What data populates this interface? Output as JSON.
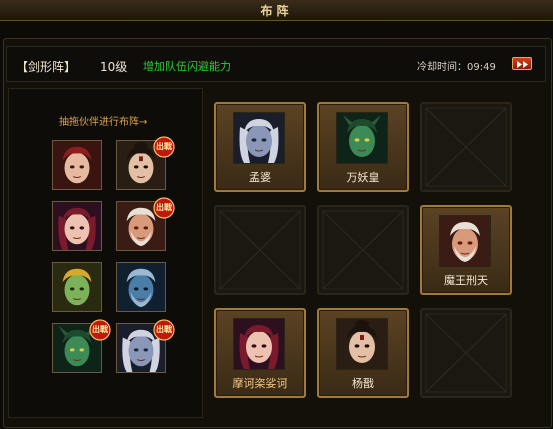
{
  "header": {
    "title": "布阵"
  },
  "formation": {
    "name": "【剑形阵】",
    "level": "10级",
    "effect": "增加队伍闪避能力",
    "cooldown": "冷却时间：09:49"
  },
  "sidebar": {
    "hint": "抽拖伙伴进行布阵→",
    "badge_text": "出戰",
    "portraits": [
      {
        "character": "red-haired-girl",
        "deployed": false
      },
      {
        "character": "scarred-warrior",
        "deployed": true
      },
      {
        "character": "long-haired-girl",
        "deployed": false
      },
      {
        "character": "white-bearded-demon",
        "deployed": true
      },
      {
        "character": "blonde-elf",
        "deployed": false
      },
      {
        "character": "blue-skinned-elder",
        "deployed": false
      },
      {
        "character": "green-demon-emperor",
        "deployed": true
      },
      {
        "character": "silver-haired-crone",
        "deployed": true
      }
    ]
  },
  "grid": {
    "slots": [
      {
        "name": "孟婆",
        "character": "silver-haired-crone",
        "filled": true
      },
      {
        "name": "万妖皇",
        "character": "green-demon-emperor",
        "filled": true
      },
      {
        "name": "",
        "filled": false
      },
      {
        "name": "",
        "filled": false
      },
      {
        "name": "",
        "filled": false
      },
      {
        "name": "魔王刑天",
        "character": "white-bearded-demon",
        "filled": true
      },
      {
        "name": "摩诃栥娑诃",
        "character": "long-haired-girl",
        "filled": true
      },
      {
        "name": "杨戬",
        "character": "scarred-warrior",
        "filled": true
      },
      {
        "name": "",
        "filled": false
      }
    ]
  },
  "colors": {
    "accent_green": "#27d12f",
    "hint_orange": "#d9a24e",
    "badge_red": "#c0180c"
  }
}
